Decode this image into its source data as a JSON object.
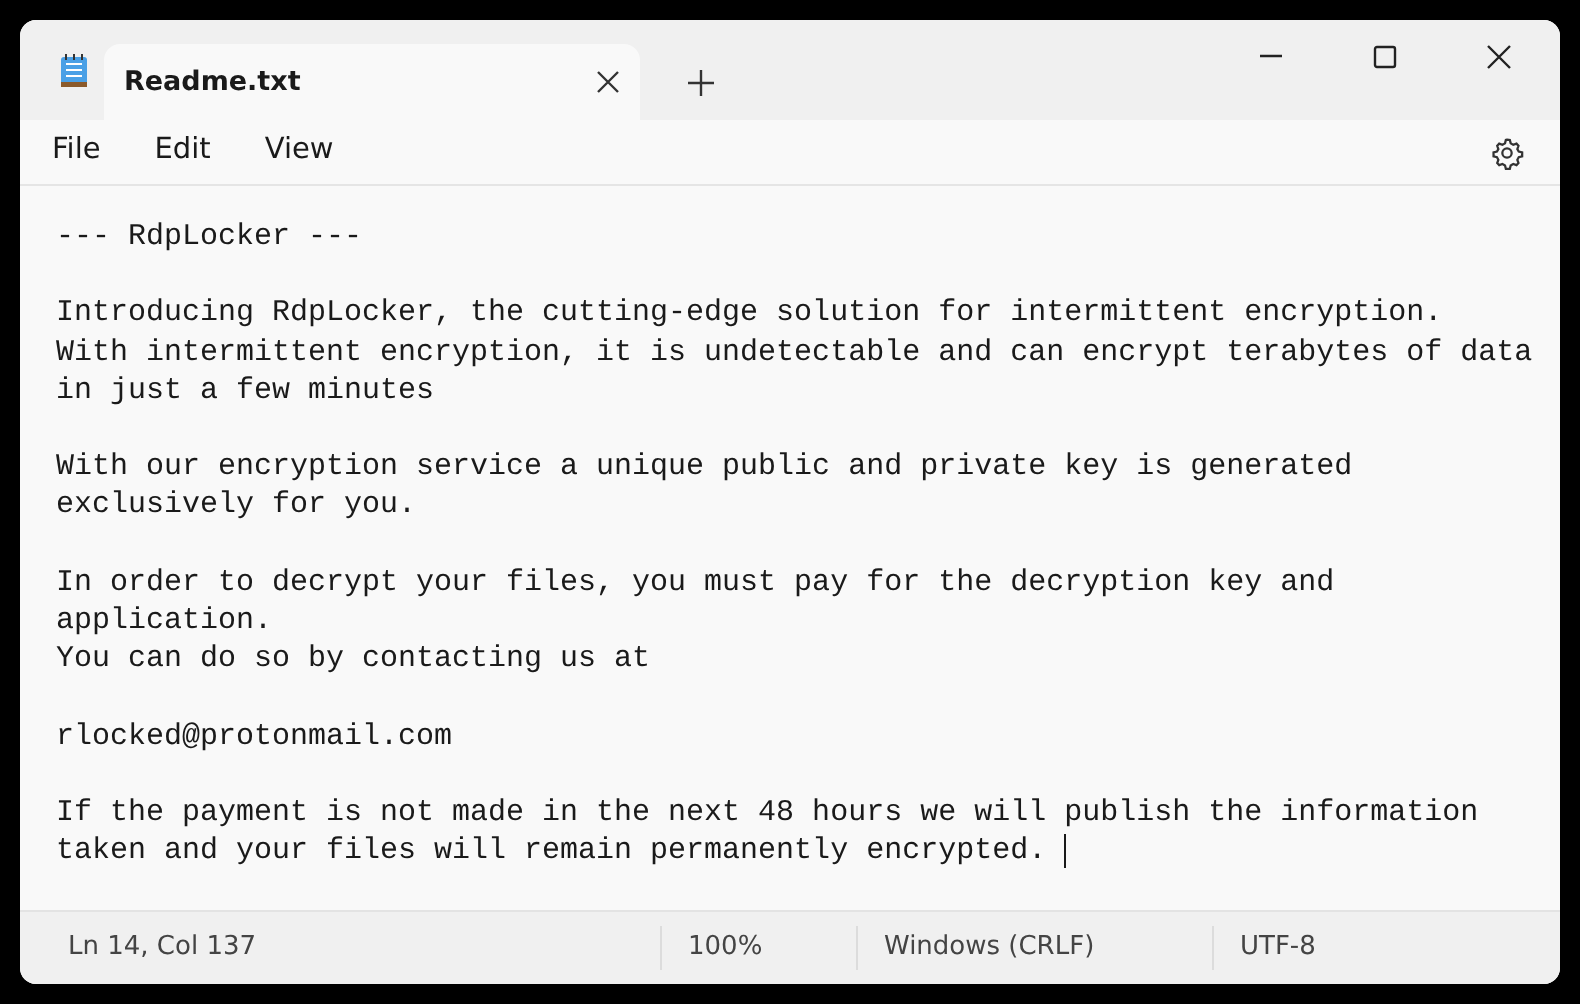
{
  "window": {
    "tab": {
      "title": "Readme.txt",
      "selected": true
    }
  },
  "menu": [
    "File",
    "Edit",
    "View"
  ],
  "document": {
    "paragraphs": [
      [
        "--- RdpLocker ---"
      ],
      [
        "Introducing RdpLocker, the cutting-edge solution for intermittent encryption.",
        "With intermittent encryption, it is undetectable and can encrypt terabytes of data",
        "in just a few minutes"
      ],
      [
        "With our encryption service a unique public and private key is generated",
        "exclusively for you."
      ],
      [
        "In order to decrypt your files, you must pay for the decryption key and",
        "application.",
        "You can do so by contacting us at"
      ],
      [
        "rlocked@protonmail.com"
      ],
      [
        "If the payment is not made in the next 48 hours we will publish the information",
        "taken and your files will remain permanently encrypted. "
      ]
    ]
  },
  "status_bar": {
    "position": "Ln 14, Col 137",
    "zoom": "100%",
    "line_endings": "Windows (CRLF)",
    "encoding": "UTF-8"
  }
}
